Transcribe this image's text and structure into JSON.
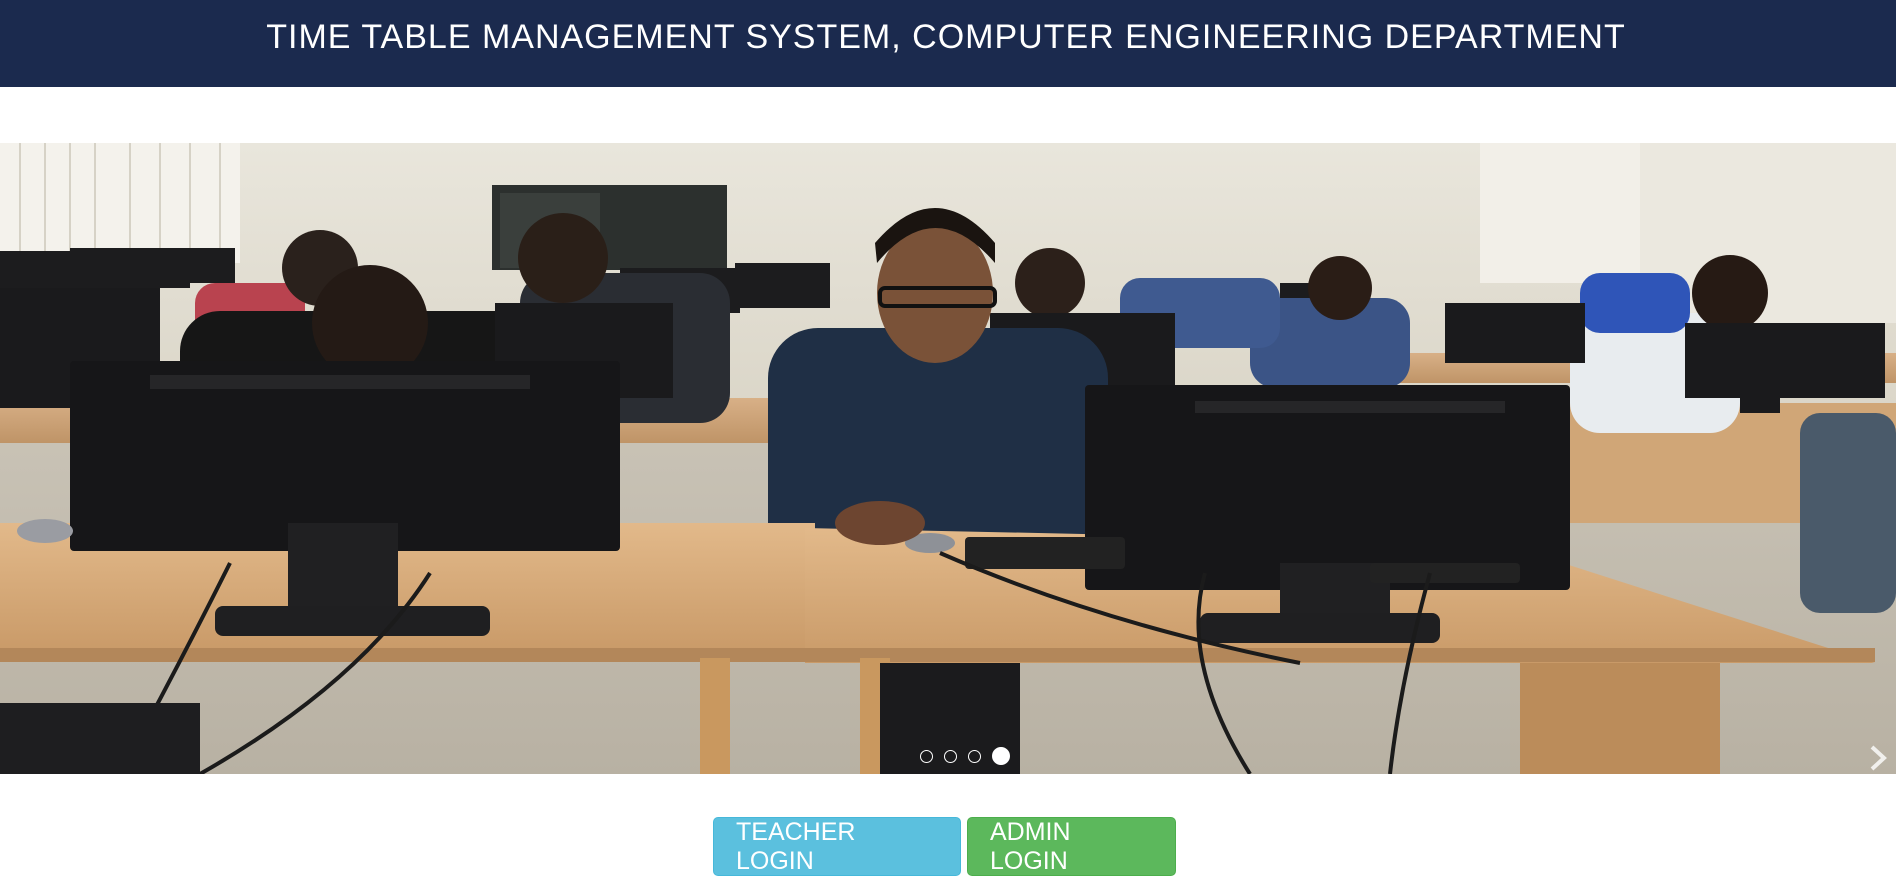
{
  "header": {
    "title": "TIME TABLE MANAGEMENT SYSTEM, COMPUTER ENGINEERING DEPARTMENT"
  },
  "carousel": {
    "slide_count": 4,
    "active_index": 3,
    "next_icon": "chevron-right-icon"
  },
  "buttons": {
    "teacher_login": "TEACHER LOGIN",
    "admin_login": "ADMIN LOGIN"
  },
  "colors": {
    "header_bg": "#1b2a4e",
    "teacher_button": "#5bc0de",
    "admin_button": "#5cb85c"
  }
}
